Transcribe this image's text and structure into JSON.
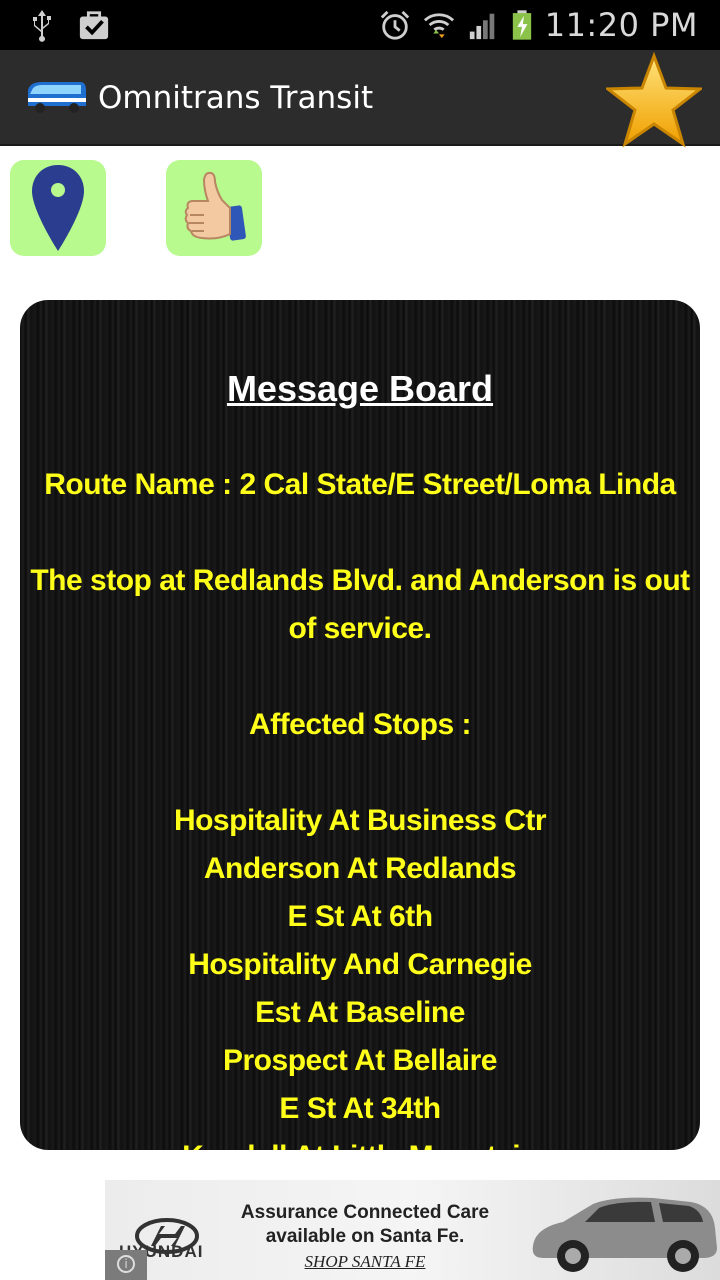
{
  "status_bar": {
    "time": "11:20 PM",
    "icons": [
      "usb-icon",
      "download-check-icon",
      "alarm-icon",
      "wifi-icon",
      "signal-icon",
      "battery-charging-icon"
    ]
  },
  "action_bar": {
    "title": "Omnitrans Transit",
    "app_icon": "bus-icon",
    "favorite_icon": "star-icon"
  },
  "toolbar": {
    "buttons": [
      {
        "icon": "map-pin-icon"
      },
      {
        "icon": "thumbs-up-icon"
      }
    ],
    "button_color": "#b8fa8e"
  },
  "message_board": {
    "title": "Message Board",
    "route": "Route Name : 2 Cal State/E Street/Loma Linda",
    "message_line_1": "The stop at Redlands Blvd. and Anderson is out",
    "message_line_2": "of service.",
    "affected_label": "Affected Stops :",
    "stops": [
      "Hospitality At Business Ctr",
      "Anderson At Redlands",
      "E St At 6th",
      "Hospitality And Carnegie",
      "Est At Baseline",
      "Prospect At Bellaire",
      "E St At 34th",
      "Kendall At Little Mountain"
    ],
    "text_color": "#ffff1a",
    "title_color": "#ffffff"
  },
  "ad": {
    "brand": "HYUNDAI",
    "line_1": "Assurance Connected Care",
    "line_2": "available on Santa Fe.",
    "cta": "SHOP SANTA FE"
  }
}
